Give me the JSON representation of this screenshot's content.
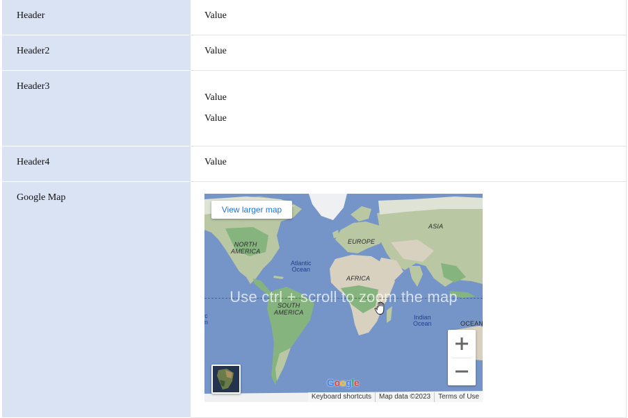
{
  "rows": [
    {
      "header": "Header",
      "value": "Value"
    },
    {
      "header": "Header2",
      "value": "Value"
    },
    {
      "header": "Header3",
      "values": [
        "Value",
        "Value"
      ]
    },
    {
      "header": "Header4",
      "value": "Value"
    },
    {
      "header": "Google Map"
    }
  ],
  "map": {
    "view_larger": "View larger map",
    "overlay_message": "Use ctrl + scroll to zoom the map",
    "labels": {
      "north_america": "NORTH\nAMERICA",
      "europe": "EUROPE",
      "asia": "ASIA",
      "africa": "AFRICA",
      "south_america": "SOUTH\nAMERICA",
      "atlantic": "Atlantic\nOcean",
      "indian": "Indian\nOcean",
      "ocean_right": "OCEAN",
      "edge_left": "c\nn"
    },
    "logo": [
      "G",
      "o",
      "o",
      "g",
      "l",
      "e"
    ],
    "logo_colors": [
      "#4285f4",
      "#ea4335",
      "#fbbc05",
      "#4285f4",
      "#34a853",
      "#ea4335"
    ],
    "attribution": {
      "shortcuts": "Keyboard shortcuts",
      "data": "Map data ©2023",
      "terms": "Terms of Use"
    },
    "colors": {
      "water": "#7595c9",
      "land": "#b9c7a3",
      "forest": "#86b47e",
      "desert": "#d8d1bf",
      "ice": "#eef0f1"
    },
    "icons": [
      "plus-icon",
      "minus-icon",
      "hand-cursor-icon",
      "satellite-thumbnail"
    ]
  }
}
